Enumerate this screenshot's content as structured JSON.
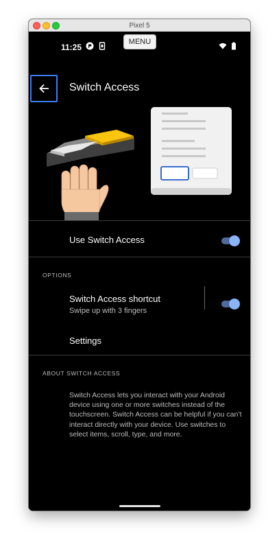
{
  "window": {
    "title": "Pixel 5"
  },
  "statusbar": {
    "time": "11:25",
    "menu_label": "MENU"
  },
  "appbar": {
    "title": "Switch Access"
  },
  "main_toggle": {
    "label": "Use Switch Access",
    "checked": true
  },
  "options": {
    "header": "OPTIONS",
    "shortcut": {
      "title": "Switch Access shortcut",
      "subtitle": "Swipe up with 3 fingers",
      "checked": true
    },
    "settings_label": "Settings"
  },
  "about": {
    "header": "ABOUT SWITCH ACCESS",
    "text": "Switch Access lets you interact with your Android device using one or more switches instead of the touchscreen. Switch Access can be helpful if you can’t interact directly with your device. Use switches to select items, scroll, type, and more."
  },
  "colors": {
    "accent": "#8ab4f8",
    "track": "#4e6a9e",
    "focus": "#3d7df6",
    "background": "#000000"
  },
  "icons": [
    "back-arrow-icon",
    "app-notification-icon",
    "sim-icon",
    "wifi-icon",
    "battery-icon"
  ]
}
